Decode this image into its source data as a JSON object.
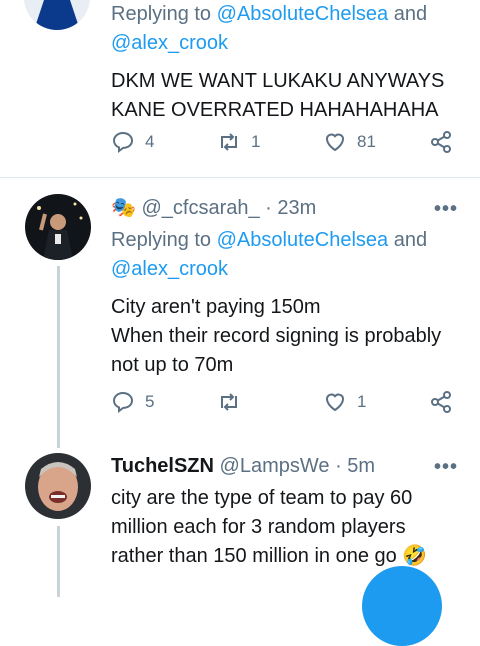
{
  "tweets": [
    {
      "reply_prefix": "Replying to",
      "mention1": "@AbsoluteChelsea",
      "and": "and",
      "mention2": "@alex_crook",
      "text_lines": [
        "DKM WE WANT LUKAKU ANYWAYS",
        "KANE OVERRATED HAHAHAHAHA"
      ],
      "replies": "4",
      "retweets": "1",
      "likes": "81"
    },
    {
      "emoji": "🎭",
      "handle": "@_cfcsarah_",
      "time": "· 23m",
      "reply_prefix": "Replying to",
      "mention1": "@AbsoluteChelsea",
      "and": "and",
      "mention2": "@alex_crook",
      "text_lines": [
        "City aren't paying 150m",
        "When their record signing is probably",
        "not up to 70m"
      ],
      "replies": "5",
      "retweets": "",
      "likes": "1"
    },
    {
      "name": "TuchelSZN",
      "handle": "@LampsWe",
      "time": "· 5m",
      "text_lines": [
        "city are the type of team to pay 60",
        "million each for 3 random players",
        "rather than 150 million in one go"
      ],
      "emoji": "🤣"
    }
  ],
  "more_label": "•••",
  "colors": {
    "accent": "#1d9bf0",
    "muted": "#5b7083",
    "divider": "#e1e8ed"
  }
}
